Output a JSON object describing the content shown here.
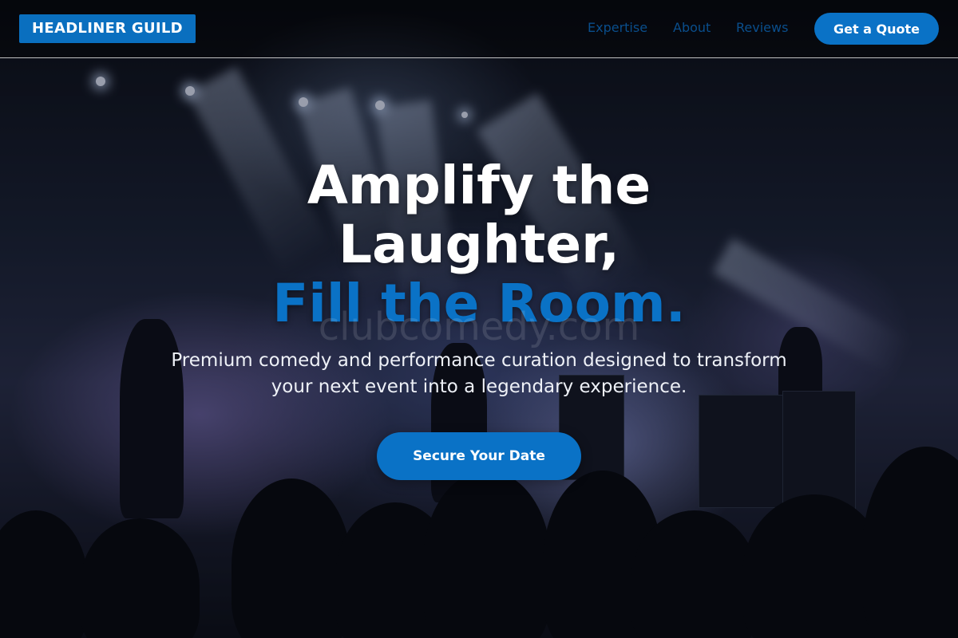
{
  "brand": {
    "name": "HEADLINER GUILD"
  },
  "nav": {
    "links": [
      "Expertise",
      "About",
      "Reviews"
    ],
    "cta_label": "Get a Quote"
  },
  "hero": {
    "headline_line1": "Amplify the",
    "headline_line2": "Laughter,",
    "headline_accent": "Fill the Room.",
    "watermark": "clubcomedy.com",
    "subtitle": "Premium comedy and performance curation designed to transform your next event into a legendary experience.",
    "cta_label": "Secure Your Date",
    "background_image": "concert stage with band and silhouetted crowd"
  },
  "colors": {
    "accent": "#0a72c6",
    "nav_link": "#0a4e8c",
    "text": "#ffffff"
  }
}
